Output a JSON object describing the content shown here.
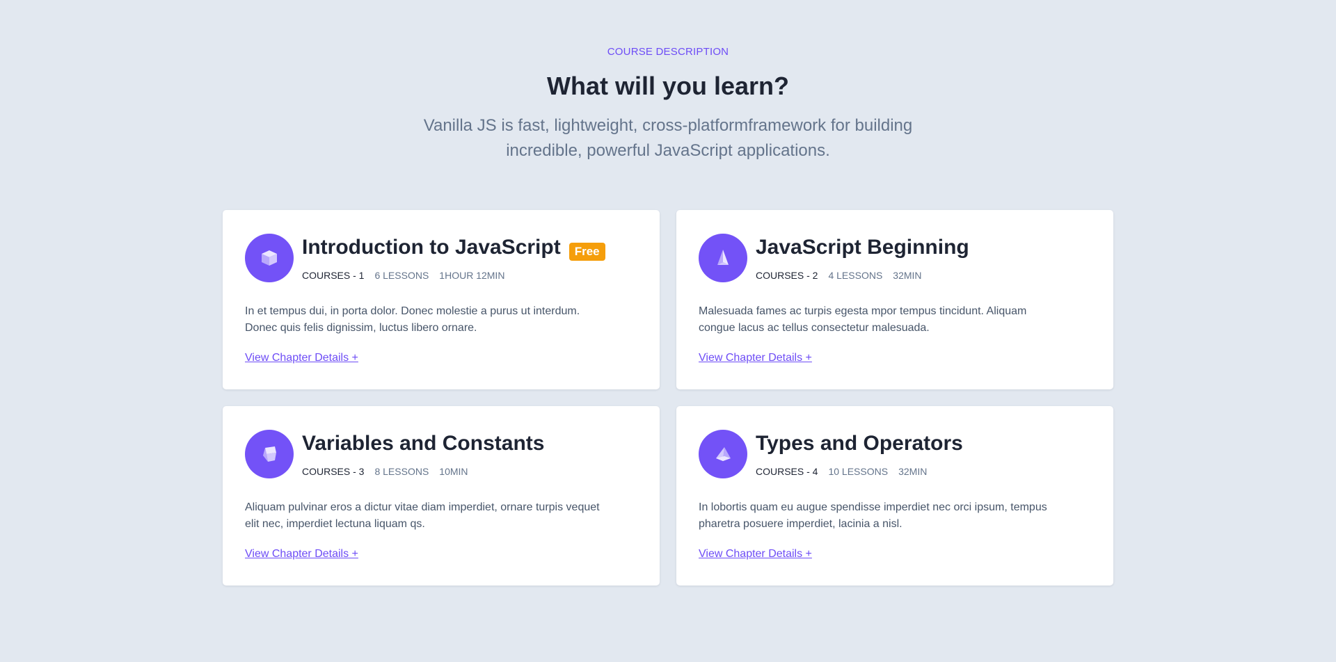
{
  "header": {
    "eyebrow": "COURSE DESCRIPTION",
    "title": "What will you learn?",
    "subtitle": "Vanilla JS is fast, lightweight, cross-platformframework for building incredible, powerful JavaScript applications."
  },
  "colors": {
    "accent": "#6d4cf6",
    "icon_bg": "#7352f7",
    "badge": "#f59e0b",
    "background": "#e2e8f0"
  },
  "cards": [
    {
      "title": "Introduction to JavaScript",
      "badge": "Free",
      "icon": "cube-icon",
      "course": "COURSES - 1",
      "lessons": "6 LESSONS",
      "duration": "1HOUR 12MIN",
      "description": "In et tempus dui, in porta dolor. Donec molestie a purus ut interdum. Donec quis felis dignissim, luctus libero ornare.",
      "link": "View Chapter Details +"
    },
    {
      "title": "JavaScript Beginning",
      "icon": "pyramid-icon",
      "course": "COURSES - 2",
      "lessons": "4 LESSONS",
      "duration": "32MIN",
      "description": "Malesuada fames ac turpis egesta mpor tempus tincidunt. Aliquam congue lacus ac tellus consectetur malesuada.",
      "link": "View Chapter Details +"
    },
    {
      "title": "Variables and Constants",
      "icon": "tilted-cube-icon",
      "course": "COURSES - 3",
      "lessons": "8 LESSONS",
      "duration": "10MIN",
      "description": "Aliquam pulvinar eros a dictur vitae diam imperdiet, ornare turpis vequet elit nec, imperdiet lectuna liquam qs.",
      "link": "View Chapter Details +"
    },
    {
      "title": "Types and Operators",
      "icon": "tetrahedron-icon",
      "course": "COURSES - 4",
      "lessons": "10 LESSONS",
      "duration": "32MIN",
      "description": "In lobortis quam eu augue spendisse imperdiet nec orci ipsum, tempus pharetra posuere imperdiet, lacinia a nisl.",
      "link": "View Chapter Details +"
    }
  ]
}
